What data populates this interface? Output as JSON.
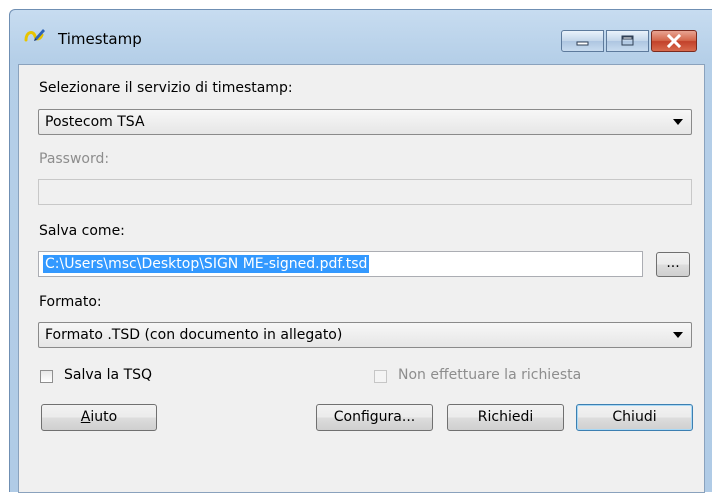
{
  "window": {
    "title": "Timestamp",
    "controls": [
      "minimize",
      "maximize",
      "close"
    ]
  },
  "service": {
    "label": "Selezionare il servizio di timestamp:",
    "selected": "Postecom TSA"
  },
  "password": {
    "label": "Password:",
    "value": ""
  },
  "save_as": {
    "label": "Salva come:",
    "value": "C:\\Users\\msc\\Desktop\\SIGN ME-signed.pdf.tsd",
    "browse_label": "..."
  },
  "format": {
    "label": "Formato:",
    "selected": "Formato .TSD (con documento in allegato)"
  },
  "options": {
    "save_tsq": "Salva la TSQ",
    "no_request": "Non effettuare la richiesta"
  },
  "buttons": {
    "help_first": "A",
    "help_rest": "iuto",
    "configure": "Configura...",
    "request": "Richiedi",
    "close": "Chiudi"
  },
  "colors": {
    "selection": "#3399ff",
    "titlebar": "#b9d1ea",
    "close_button": "#c9452d"
  }
}
